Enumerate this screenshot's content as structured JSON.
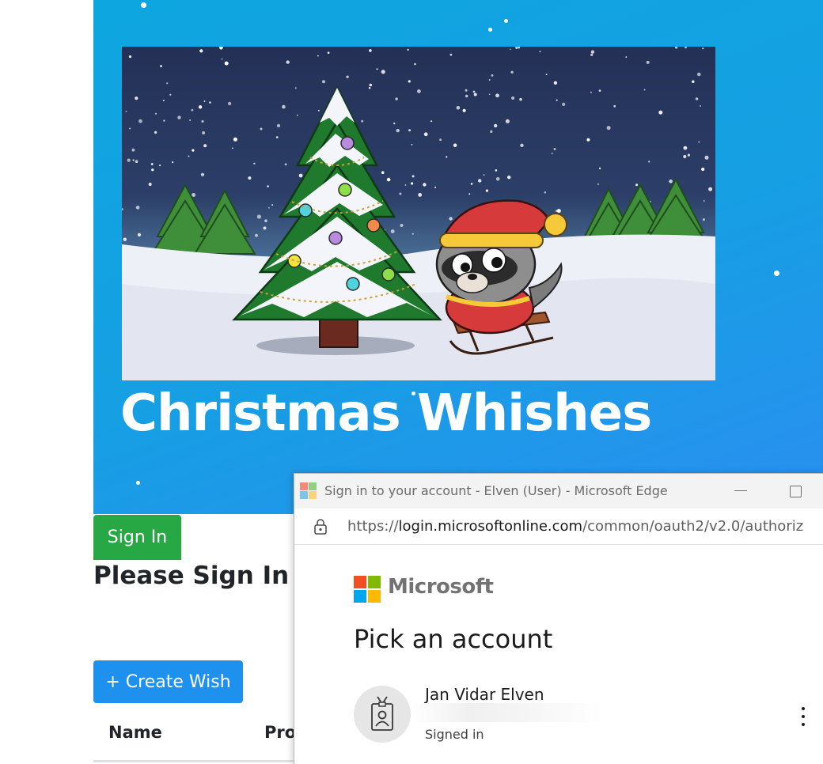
{
  "hero": {
    "title": "Christmas Whishes",
    "banner_alt": "Christmas banner with snowy trees and a raccoon on a sled"
  },
  "auth": {
    "sign_in_label": "Sign In",
    "prompt_heading": "Please Sign In to"
  },
  "wishes": {
    "create_label": "+ Create Wish",
    "columns": [
      "Name",
      "Pro"
    ]
  },
  "popup": {
    "window_title": "Sign in to your account - Elven (User) - Microsoft Edge",
    "url_scheme": "https://",
    "url_host": "login.microsoftonline.com",
    "url_path": "/common/oauth2/v2.0/authoriz",
    "brand": "Microsoft",
    "heading": "Pick an account",
    "account": {
      "name": "Jan Vidar Elven",
      "status": "Signed in"
    }
  },
  "colors": {
    "hero_blue": "#169fe3",
    "sign_in_green": "#28a745",
    "create_blue": "#1e90ee"
  },
  "icons": [
    "edge-logo-icon",
    "minimize-icon",
    "maximize-icon",
    "lock-icon",
    "microsoft-logo-icon",
    "account-badge-icon",
    "more-options-icon"
  ]
}
